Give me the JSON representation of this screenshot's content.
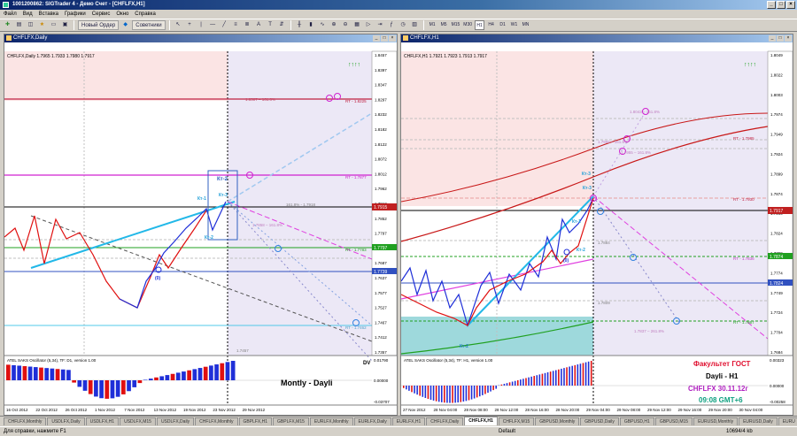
{
  "app": {
    "title": "1001200862: SIGTrader 4 - Демо Счет - [CHFLFX,H1]"
  },
  "menu": [
    "Файл",
    "Вид",
    "Вставка",
    "Графики",
    "Сервис",
    "Окно",
    "Справка"
  ],
  "toolbar": {
    "new_order": "Новый Ордер",
    "experts": "Советники",
    "timeframes": [
      "M1",
      "M5",
      "M15",
      "M30",
      "H1",
      "H4",
      "D1",
      "W1",
      "MN"
    ]
  },
  "left_chart": {
    "window_title": "CHFLFX,Daily",
    "info": "CHFLFX,Daily  1.7965 1.7933 1.7980 1.7917",
    "price_labels": [
      "1.8457",
      "1.8397",
      "1.8347",
      "1.8297",
      "1.8232",
      "1.8182",
      "1.8122",
      "1.8072",
      "1.8012",
      "1.7962",
      "1.7912",
      "1.7852",
      "1.7797",
      "1.7742",
      "1.7687",
      "1.7637",
      "1.7577",
      "1.7527",
      "1.7467",
      "1.7412",
      "1.7357"
    ],
    "current_price": "1.7915",
    "marker_prices": [
      "1.7797",
      "1.7739"
    ],
    "level_labels": [
      "1.8307 – 161.8%",
      "RT - 1.8225",
      "RT - 1.7877",
      "161.8% - 1.7918",
      "1.7858 – 161.8%",
      "RT - 1.7783",
      "RT - 1.7462",
      "1.7457"
    ],
    "wave_labels": [
      "Кт-1",
      "Кт-2",
      "Кт-3",
      "Кт-2",
      "(0)"
    ],
    "arrows": "↑↑↑↑",
    "dates": [
      "16 Oct 2012",
      "22 Oct 2012",
      "26 Oct 2012",
      "1 Nov 2012",
      "7 Nov 2012",
      "13 Nov 2012",
      "19 Nov 2012",
      "23 Nov 2012",
      "29 Nov 2012"
    ],
    "osc_title": "ATEL SAKS Oscillator (5,34), TF: D1, version 1.00",
    "osc_dv": "DV",
    "osc_scale": [
      "0.01790",
      "0.00000",
      "-0.03707"
    ],
    "caption": "Montly - Dayli"
  },
  "right_chart": {
    "window_title": "CHFLFX,H1",
    "info": "CHFLFX,H1  1.7921 1.7923 1.7913 1.7917",
    "price_labels": [
      "1.8049",
      "1.8022",
      "1.8003",
      "1.7974",
      "1.7949",
      "1.7924",
      "1.7899",
      "1.7874",
      "1.7849",
      "1.7824",
      "1.7799",
      "1.7774",
      "1.7749",
      "1.7724",
      "1.7704",
      "1.7684"
    ],
    "current_price": "1.7917",
    "marker_prices": [
      "1.7874",
      "1.7824"
    ],
    "level_labels": [
      "1.8043 – 161.8%",
      "RT - 1.7985",
      "1.7965 – 161.8%",
      "1.7955 – 161.8%",
      "RT - 1.7930",
      "1.7884",
      "RT - 1.7836",
      "1.7809",
      "RT - 1.7867",
      "1.7837 – 261.8%"
    ],
    "wave_labels": [
      "Кт-3",
      "Кт-3",
      "Кт-1",
      "Кт-2",
      "(0)",
      "Кт-2"
    ],
    "arrows": "↑↑↑↑",
    "dates": [
      "27 Nov 2012",
      "28 Nov 04:00",
      "28 Nov 08:00",
      "28 Nov 12:00",
      "28 Nov 16:00",
      "28 Nov 20:00",
      "29 Nov 04:00",
      "29 Nov 08:00",
      "29 Nov 12:00",
      "29 Nov 16:00",
      "29 Nov 20:00",
      "30 Nov 04:00"
    ],
    "osc_title": "ATEL SAKS Oscillator (5,34), TF: H1, version 1.00",
    "osc_scale": [
      "0.00323",
      "0.00000",
      "-0.00258"
    ],
    "caption": {
      "line1": "Факультет ГОСТ",
      "line2": "Dayli - H1",
      "line3": "CHFLFX 30.11.12г",
      "line4": "09:08 GMT+6"
    }
  },
  "tabs": [
    "CHFLFX,Monthly",
    "USDLFX,Daily",
    "USDLFX,H1",
    "USDLFX,M15",
    "USDLFX,Daily",
    "CHFLFX,Monthly",
    "GBPLFX,H1",
    "GBPLFX,M15",
    "EURLFX,Monthly",
    "EURLFX,Daily",
    "EURLFX,H1",
    "CHFLFX,Daily",
    "CHFLFX,H1",
    "CHFLFX,M15",
    "GBPUSD,Monthly",
    "GBPUSD,Daily",
    "GBPUSD,H1",
    "GBPUSD,M15",
    "EURUSD,Monthly",
    "EURUSD,Daily",
    "EURU"
  ],
  "active_tab_index": 12,
  "status": {
    "help": "Для справки, нажмите F1",
    "profile": "Default",
    "traffic": "10694/4 kb"
  },
  "colors": {
    "bull": "#1f2fd8",
    "bear": "#e01010",
    "trend": "#22b8e8",
    "fib": "#d020d0",
    "support": "#20a020"
  }
}
